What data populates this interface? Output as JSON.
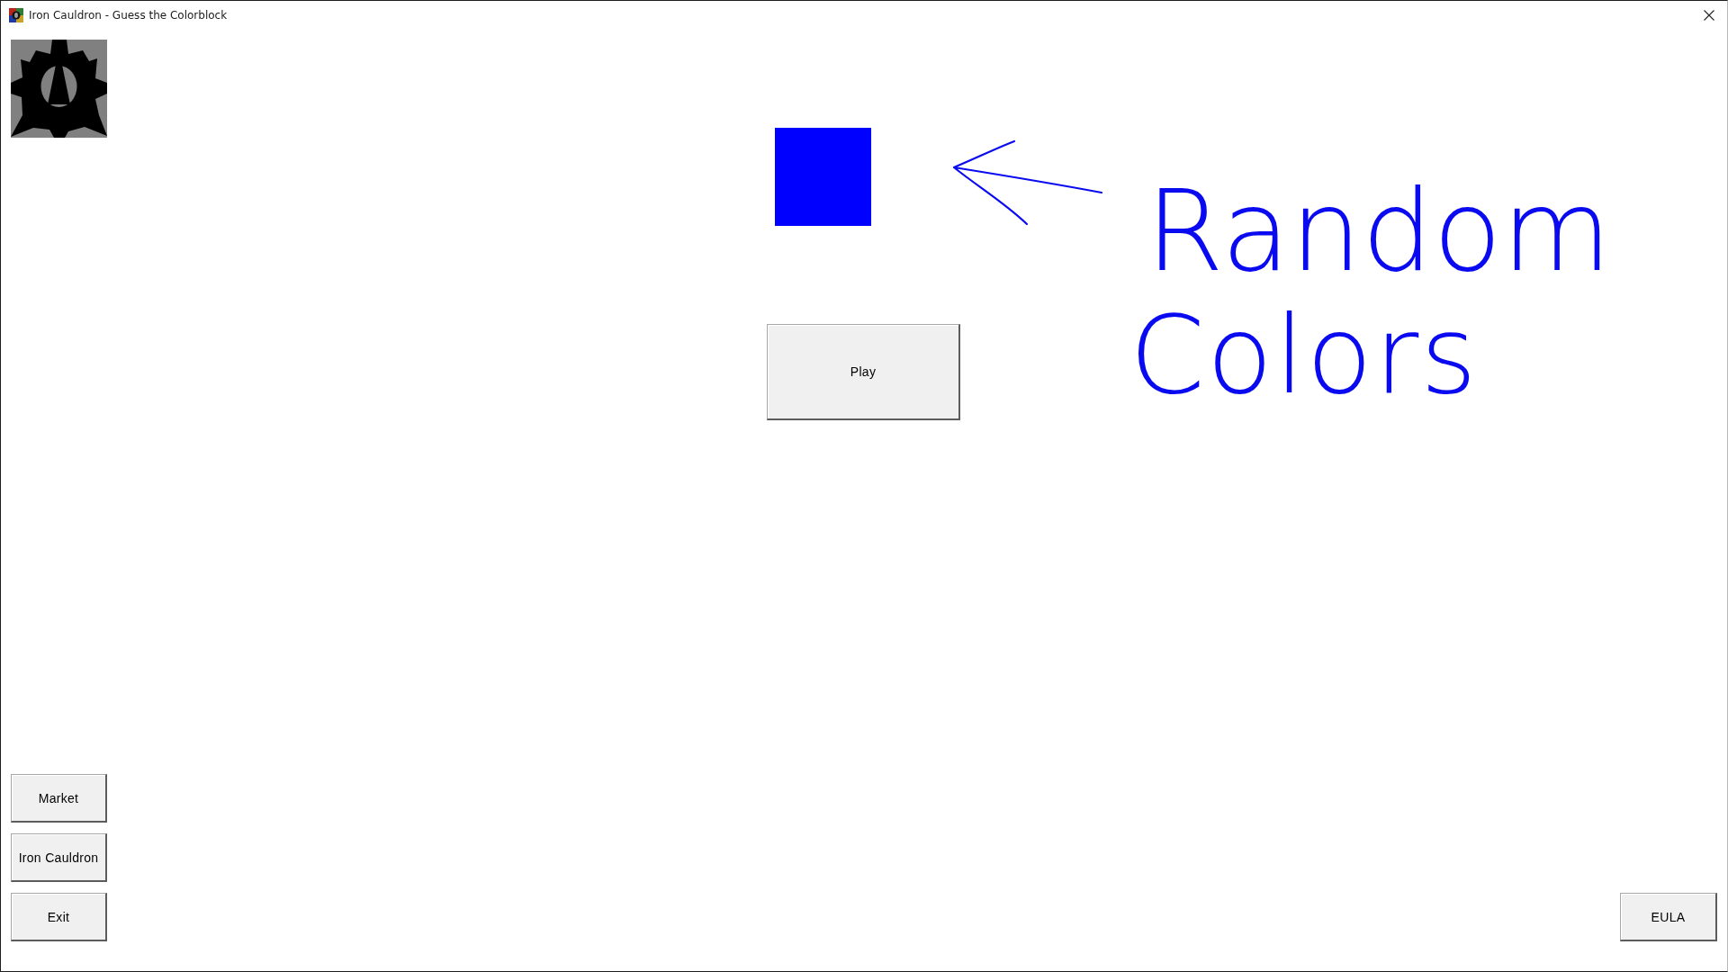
{
  "window": {
    "title": "Iron Cauldron - Guess the Colorblock"
  },
  "color_block": {
    "color": "#0000ff"
  },
  "annotation": {
    "lines": [
      "Random",
      "Colors"
    ]
  },
  "play_button": {
    "label": "Play"
  },
  "side_buttons": [
    {
      "label": "Market"
    },
    {
      "label": "Iron Cauldron"
    },
    {
      "label": "Exit"
    }
  ],
  "eula_button": {
    "label": "EULA"
  }
}
